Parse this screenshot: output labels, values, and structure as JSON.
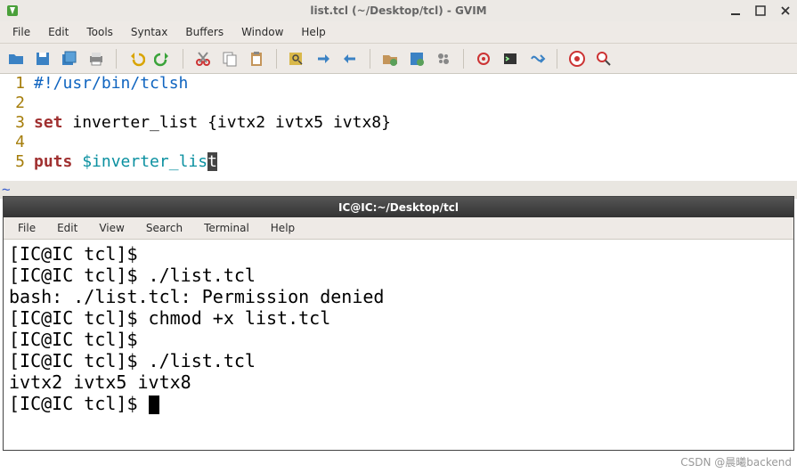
{
  "gvim": {
    "title": "list.tcl (~/Desktop/tcl) - GVIM",
    "menu": [
      "File",
      "Edit",
      "Tools",
      "Syntax",
      "Buffers",
      "Window",
      "Help"
    ],
    "toolbar_icons": [
      "open-icon",
      "save-icon",
      "save-all-icon",
      "print-icon",
      "sep",
      "undo-icon",
      "redo-icon",
      "sep",
      "cut-icon",
      "copy-icon",
      "paste-icon",
      "sep",
      "find-replace-icon",
      "find-next-icon",
      "find-prev-icon",
      "sep",
      "load-session-icon",
      "save-session-icon",
      "run-script-icon",
      "sep",
      "make-icon",
      "shell-icon",
      "tags-icon",
      "sep",
      "help-icon",
      "find-help-icon"
    ],
    "gutter": [
      "1",
      "2",
      "3",
      "4",
      "5"
    ],
    "code": {
      "l1_shebang": "#!/usr/bin/tclsh",
      "l3_kw": "set",
      "l3_rest": " inverter_list {ivtx2 ivtx5 ivtx8}",
      "l5_kw": "puts",
      "l5_var_pre": " $inverter_lis",
      "l5_var_cur": "t"
    },
    "tilde": "~"
  },
  "terminal": {
    "title": "IC@IC:~/Desktop/tcl",
    "menu": [
      "File",
      "Edit",
      "View",
      "Search",
      "Terminal",
      "Help"
    ],
    "lines": [
      "[IC@IC tcl]$ ",
      "[IC@IC tcl]$ ./list.tcl",
      "bash: ./list.tcl: Permission denied",
      "[IC@IC tcl]$ chmod +x list.tcl",
      "[IC@IC tcl]$ ",
      "[IC@IC tcl]$ ./list.tcl",
      "ivtx2 ivtx5 ivtx8",
      "[IC@IC tcl]$ "
    ]
  },
  "watermark": "CSDN @晨曦backend"
}
